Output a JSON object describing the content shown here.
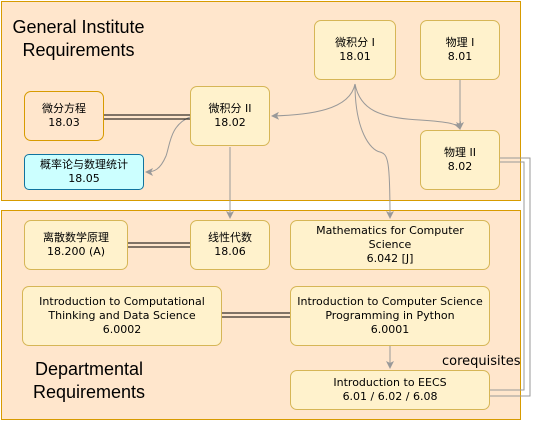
{
  "regions": {
    "general": {
      "title_line1": "General Institute",
      "title_line2": "Requirements"
    },
    "departmental": {
      "title_line1": "Departmental",
      "title_line2": "Requirements"
    }
  },
  "nodes": {
    "calc1": {
      "name": "微积分 I",
      "code": "18.01"
    },
    "physics1": {
      "name": "物理 I",
      "code": "8.01"
    },
    "diffeq": {
      "name": "微分方程",
      "code": "18.03"
    },
    "calc2": {
      "name": "微积分 II",
      "code": "18.02"
    },
    "physics2": {
      "name": "物理 II",
      "code": "8.02"
    },
    "prob": {
      "name": "概率论与数理统计",
      "code": "18.05"
    },
    "discrete": {
      "name": "离散数学原理",
      "code": "18.200 (A)"
    },
    "linalg": {
      "name": "线性代数",
      "code": "18.06"
    },
    "mcs": {
      "name": "Mathematics for Computer Science",
      "code": "6.042 [J]"
    },
    "comp_thinking": {
      "name_line1": "Introduction to Computational",
      "name_line2": "Thinking and Data Science",
      "code": "6.0002"
    },
    "intro_cs": {
      "name_line1": "Introduction to Computer Science",
      "name_line2": "Programming in Python",
      "code": "6.0001"
    },
    "eecs": {
      "name": "Introduction to EECS",
      "code": "6.01 / 6.02 / 6.08"
    }
  },
  "labels": {
    "corequisites": "corequisites"
  },
  "colors": {
    "region_fill": "#ffe6cc",
    "node_fill": "#fff2cc",
    "node_border": "#d6b656",
    "highlight_fill": "#ccffff",
    "arrow": "#999999"
  }
}
